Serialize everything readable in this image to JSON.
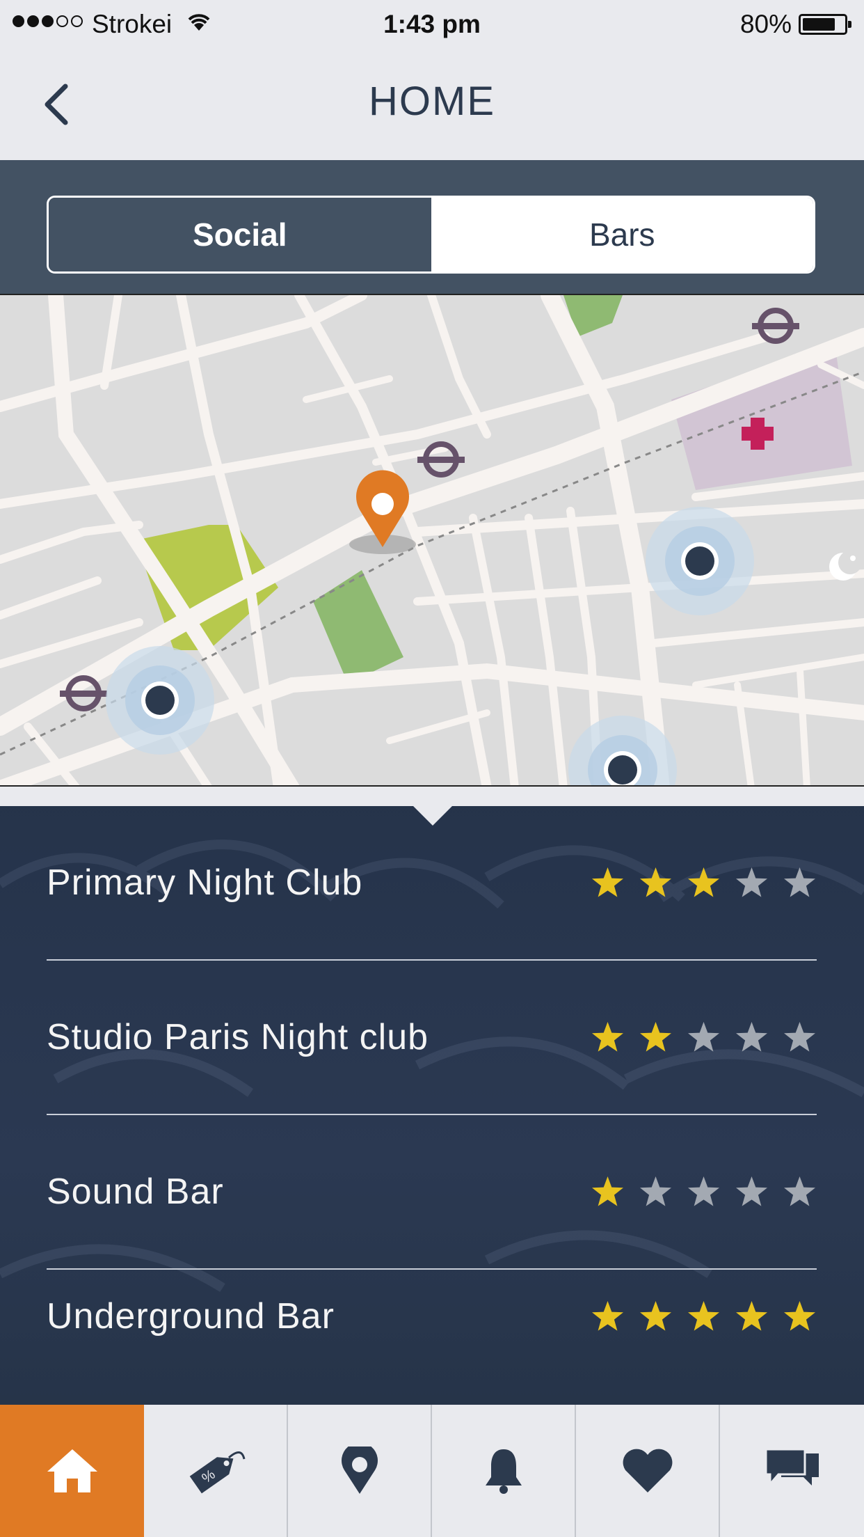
{
  "status_bar": {
    "carrier": "Strokei",
    "time": "1:43 pm",
    "battery": "80%",
    "battery_level": 0.8
  },
  "header": {
    "title": "HOME",
    "back_icon": "chevron-left-icon"
  },
  "segment": {
    "options": [
      "Social",
      "Bars"
    ],
    "selected": "Social"
  },
  "map": {
    "icons": [
      "location-pin-icon",
      "underground-station-icon",
      "hospital-icon",
      "mosque-icon",
      "map-marker-dot-icon"
    ]
  },
  "venues": [
    {
      "name": "Primary Night Club",
      "rating": 3,
      "max_rating": 5
    },
    {
      "name": "Studio Paris Night club",
      "rating": 2,
      "max_rating": 5
    },
    {
      "name": "Sound Bar",
      "rating": 1,
      "max_rating": 5
    },
    {
      "name": "Underground Bar",
      "rating": 5,
      "max_rating": 5
    }
  ],
  "tab_bar": {
    "items": [
      {
        "icon": "home-icon",
        "active": true
      },
      {
        "icon": "discount-tag-icon",
        "active": false
      },
      {
        "icon": "location-icon",
        "active": false
      },
      {
        "icon": "bell-icon",
        "active": false
      },
      {
        "icon": "heart-icon",
        "active": false
      },
      {
        "icon": "chat-icon",
        "active": false
      }
    ]
  },
  "colors": {
    "accent": "#e07a24",
    "navy": "#2c3a4e",
    "segment_bg": "#435263",
    "star_on": "#e8c31f",
    "star_off": "#a3a9b2"
  }
}
